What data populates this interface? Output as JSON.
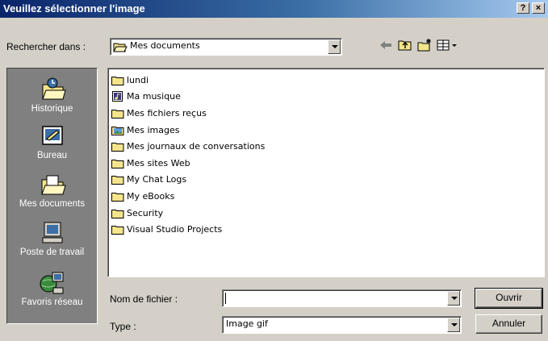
{
  "window": {
    "title": "Veuillez sélectionner l'image",
    "help_label": "?",
    "close_label": "×"
  },
  "lookin": {
    "label": "Rechercher dans :",
    "value": "Mes documents"
  },
  "toolbar": {
    "icons": [
      "back-arrow-icon",
      "up-folder-icon",
      "new-folder-icon",
      "view-menu-icon"
    ]
  },
  "places": [
    {
      "label": "Historique",
      "icon": "history-icon"
    },
    {
      "label": "Bureau",
      "icon": "desktop-icon"
    },
    {
      "label": "Mes documents",
      "icon": "my-documents-icon"
    },
    {
      "label": "Poste de travail",
      "icon": "my-computer-icon"
    },
    {
      "label": "Favoris réseau",
      "icon": "network-places-icon"
    }
  ],
  "files": [
    {
      "name": "lundi",
      "icon": "folder-icon"
    },
    {
      "name": "Ma musique",
      "icon": "music-folder-icon"
    },
    {
      "name": "Mes fichiers reçus",
      "icon": "folder-icon"
    },
    {
      "name": "Mes images",
      "icon": "pictures-folder-icon"
    },
    {
      "name": "Mes journaux de conversations",
      "icon": "folder-icon"
    },
    {
      "name": "Mes sites Web",
      "icon": "folder-icon"
    },
    {
      "name": "My Chat Logs",
      "icon": "folder-icon"
    },
    {
      "name": "My eBooks",
      "icon": "folder-icon"
    },
    {
      "name": "Security",
      "icon": "folder-icon"
    },
    {
      "name": "Visual Studio Projects",
      "icon": "folder-icon"
    }
  ],
  "filename": {
    "label": "Nom de fichier :",
    "value": ""
  },
  "filetype": {
    "label": "Type :",
    "value": "Image gif"
  },
  "buttons": {
    "open": "Ouvrir",
    "cancel": "Annuler"
  },
  "colors": {
    "titlebar_start": "#0a246a",
    "titlebar_end": "#a6caf0",
    "face": "#d4d0c8",
    "places_bar": "#808080",
    "folder": "#f4e48c"
  }
}
